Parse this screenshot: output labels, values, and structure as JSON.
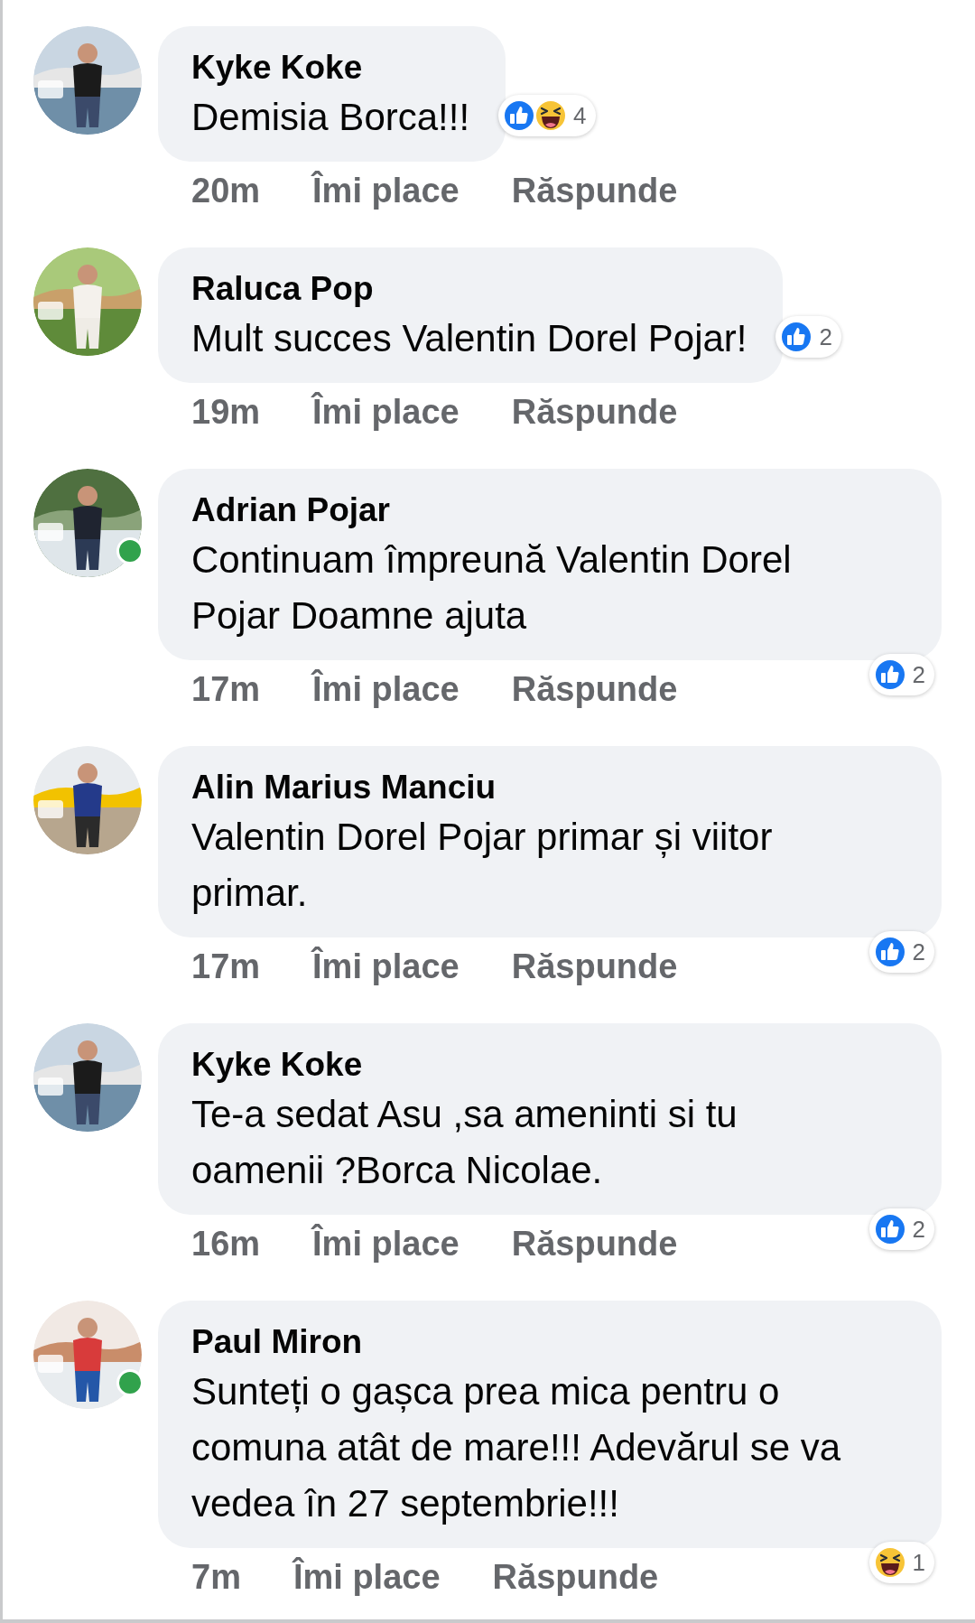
{
  "comments": [
    {
      "author": "Kyke Koke",
      "text": "Demisia Borca!!!",
      "online": false,
      "time": "20m",
      "like_label": "Îmi place",
      "reply_label": "Răspunde",
      "reactions": {
        "icons": [
          {
            "kind": "like"
          },
          {
            "kind": "haha"
          }
        ],
        "count": "4"
      }
    },
    {
      "author": "Raluca Pop",
      "text": "Mult succes Valentin Dorel Pojar!",
      "online": false,
      "time": "19m",
      "like_label": "Îmi place",
      "reply_label": "Răspunde",
      "reactions": {
        "icons": [
          {
            "kind": "like"
          }
        ],
        "count": "2"
      }
    },
    {
      "author": "Adrian Pojar",
      "text": "Continuam împreună Valentin Dorel Pojar Doamne ajuta",
      "online": true,
      "time": "17m",
      "like_label": "Îmi place",
      "reply_label": "Răspunde",
      "reactions": {
        "icons": [
          {
            "kind": "like"
          }
        ],
        "count": "2"
      }
    },
    {
      "author": "Alin Marius Manciu",
      "text": "Valentin Dorel Pojar primar și viitor primar.",
      "online": false,
      "time": "17m",
      "like_label": "Îmi place",
      "reply_label": "Răspunde",
      "reactions": {
        "icons": [
          {
            "kind": "like"
          }
        ],
        "count": "2"
      }
    },
    {
      "author": "Kyke Koke",
      "text": "Te-a sedat Asu ,sa ameninti si tu oamenii ?Borca Nicolae.",
      "online": false,
      "time": "16m",
      "like_label": "Îmi place",
      "reply_label": "Răspunde",
      "reactions": {
        "icons": [
          {
            "kind": "like"
          }
        ],
        "count": "2"
      }
    },
    {
      "author": "Paul Miron",
      "text": "Sunteți o gașca prea mica pentru o comuna atât de mare!!! Adevărul se va vedea în 27 septembrie!!!",
      "online": true,
      "time": "7m",
      "like_label": "Îmi place",
      "reply_label": "Răspunde",
      "reactions": {
        "icons": [
          {
            "kind": "haha"
          }
        ],
        "count": "1"
      }
    }
  ]
}
